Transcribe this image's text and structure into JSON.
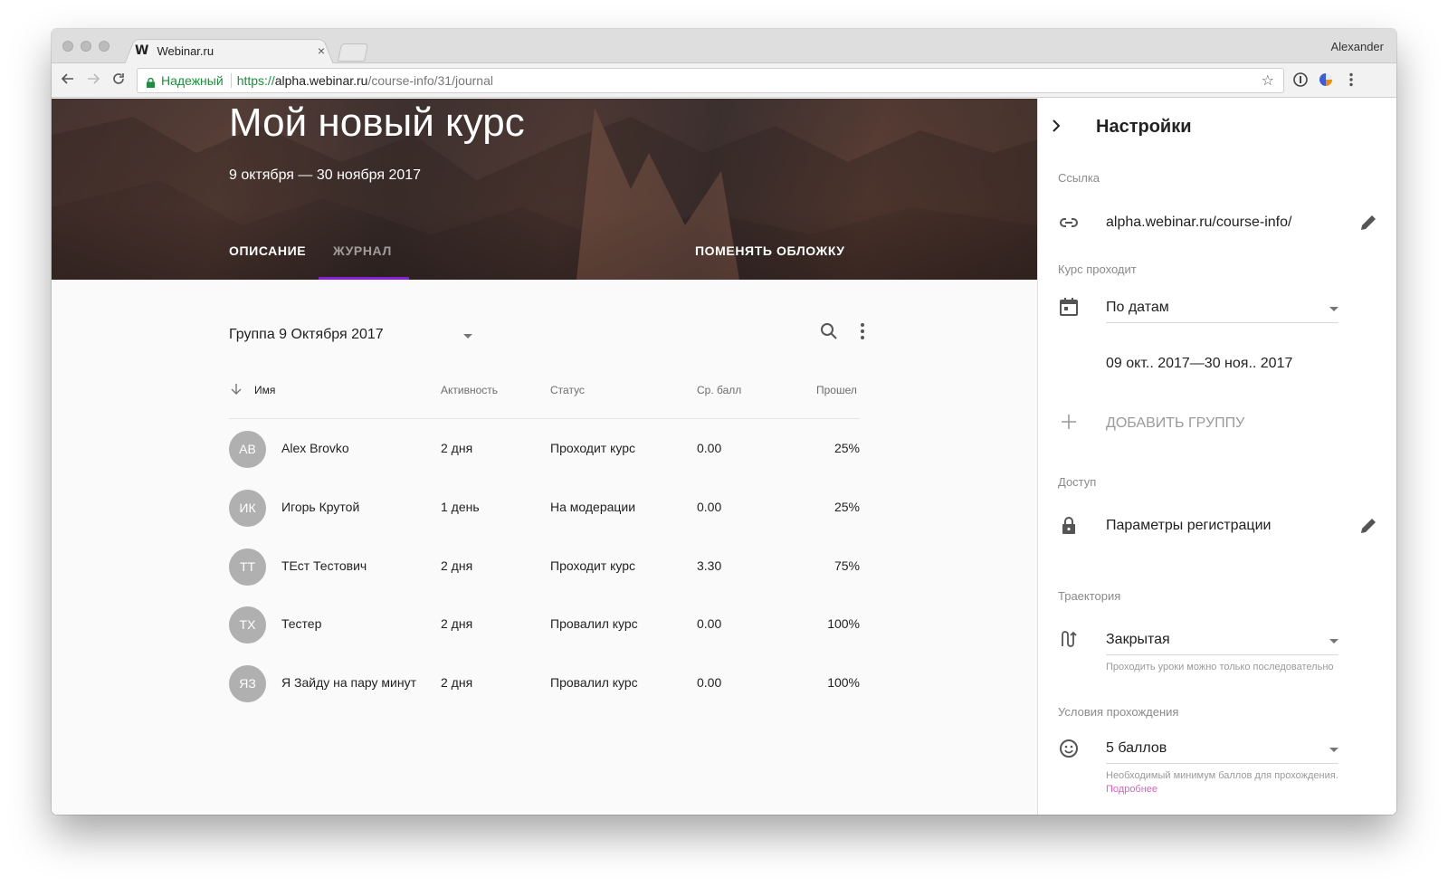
{
  "browser": {
    "tab_title": "Webinar.ru",
    "tab_favicon": "W",
    "tab_close": "×",
    "profile_name": "Alexander",
    "secure_label": "Надежный",
    "url_scheme": "https://",
    "url_host": "alpha.webinar.ru",
    "url_path": "/course-info/31/journal"
  },
  "hero": {
    "title": "Мой новый курс",
    "dates": "9 октября — 30 ноября 2017",
    "tabs": [
      {
        "label": "ОПИСАНИЕ",
        "active": false
      },
      {
        "label": "ЖУРНАЛ",
        "active": true
      }
    ],
    "change_cover_label": "ПОМЕНЯТЬ ОБЛОЖКУ",
    "accent_color": "#8a1fd6"
  },
  "journal": {
    "group_select": "Группа 9 Октября 2017",
    "columns": {
      "name": "Имя",
      "activity": "Активность",
      "status": "Статус",
      "avg_score": "Ср. балл",
      "passed": "Прошел"
    },
    "rows": [
      {
        "initials": "AB",
        "name": "Alex Brovko",
        "activity": "2 дня",
        "status": "Проходит курс",
        "avg": "0.00",
        "passed": "25%"
      },
      {
        "initials": "ИК",
        "name": "Игорь Крутой",
        "activity": "1 день",
        "status": "На модерации",
        "avg": "0.00",
        "passed": "25%"
      },
      {
        "initials": "ТТ",
        "name": "ТЕст Тестович",
        "activity": "2 дня",
        "status": "Проходит курс",
        "avg": "3.30",
        "passed": "75%"
      },
      {
        "initials": "ТХ",
        "name": "Тестер",
        "activity": "2 дня",
        "status": "Провалил курс",
        "avg": "0.00",
        "passed": "100%"
      },
      {
        "initials": "ЯЗ",
        "name": "Я Зайду на пару минут",
        "activity": "2 дня",
        "status": "Провалил курс",
        "avg": "0.00",
        "passed": "100%"
      }
    ]
  },
  "settings": {
    "title": "Настройки",
    "link_label": "Ссылка",
    "link_value": "alpha.webinar.ru/course-info/",
    "course_mode_label": "Курс проходит",
    "course_mode_value": "По датам",
    "course_dates": "09 окт.. 2017—30 ноя.. 2017",
    "add_group": "ДОБАВИТЬ ГРУППУ",
    "access_label": "Доступ",
    "access_value": "Параметры регистрации",
    "trajectory_label": "Траектория",
    "trajectory_value": "Закрытая",
    "trajectory_help": "Проходить уроки можно только последовательно",
    "conditions_label": "Условия прохождения",
    "conditions_value": "5 баллов",
    "conditions_help": "Необходимый минимум баллов для прохождения.",
    "conditions_more": "Подробнее",
    "link_color": "#e05fbd"
  }
}
